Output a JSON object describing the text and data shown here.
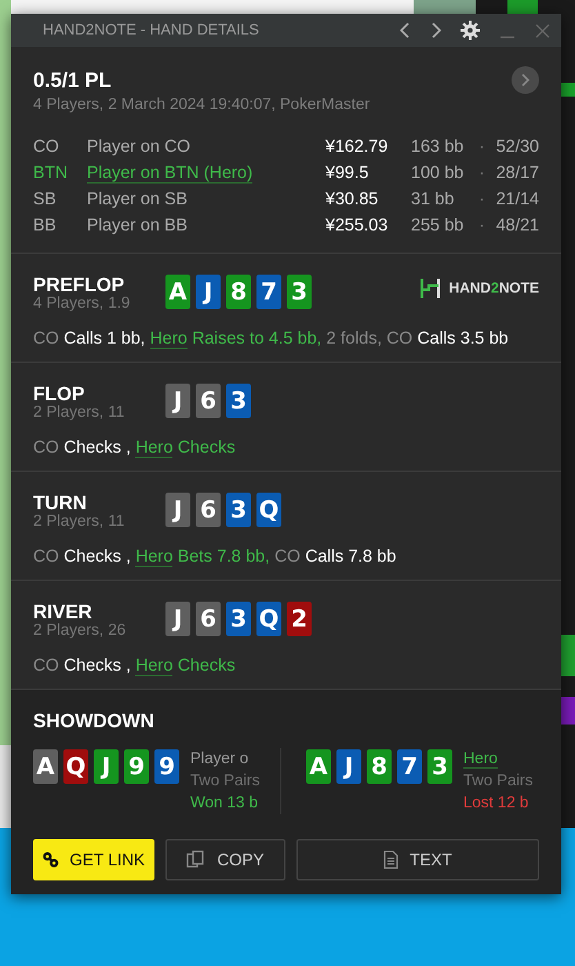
{
  "window": {
    "title": "HAND2NOTE - HAND DETAILS"
  },
  "header": {
    "title": "0.5/1 PL",
    "subtitle": "4 Players, 2 March 2024 19:40:07, PokerMaster"
  },
  "players": [
    {
      "position": "CO",
      "name": "Player on CO",
      "stack": "¥162.79",
      "bb": "163 bb",
      "stats": "52/30",
      "sep": "·",
      "hero": false
    },
    {
      "position": "BTN",
      "name": "Player on BTN (Hero)",
      "stack": "¥99.5",
      "bb": "100 bb",
      "stats": "28/17",
      "sep": "·",
      "hero": true
    },
    {
      "position": "SB",
      "name": "Player on SB",
      "stack": "¥30.85",
      "bb": "31 bb",
      "stats": "21/14",
      "sep": "·",
      "hero": false
    },
    {
      "position": "BB",
      "name": "Player on BB",
      "stack": "¥255.03",
      "bb": "255 bb",
      "stats": "48/21",
      "sep": "·",
      "hero": false
    }
  ],
  "streets": [
    {
      "name": "PREFLOP",
      "info": "4 Players, 1.9",
      "logo": [
        {
          "text": "HAND",
          "accent": false
        },
        {
          "text": "2",
          "accent": true
        },
        {
          "text": "NOTE",
          "accent": false
        }
      ],
      "cards": [
        {
          "rank": "A",
          "color": "#15951f"
        },
        {
          "rank": "J",
          "color": "#0b5cb3"
        },
        {
          "rank": "8",
          "color": "#15951f"
        },
        {
          "rank": "7",
          "color": "#0b5cb3"
        },
        {
          "rank": "3",
          "color": "#15951f"
        }
      ],
      "actions": [
        {
          "kind": "player",
          "text": "CO"
        },
        {
          "kind": "action",
          "text": " Calls 1 bb, "
        },
        {
          "kind": "hero",
          "text": "Hero"
        },
        {
          "kind": "hero_action",
          "text": " Raises to 4.5 bb,"
        },
        {
          "kind": "player",
          "text": " 2 folds, CO"
        },
        {
          "kind": "action",
          "text": " Calls 3.5 bb"
        }
      ]
    },
    {
      "name": "FLOP",
      "info": "2 Players, 11",
      "cards": [
        {
          "rank": "J",
          "color": "#5f5f5f"
        },
        {
          "rank": "6",
          "color": "#5f5f5f"
        },
        {
          "rank": "3",
          "color": "#0b5cb3"
        }
      ],
      "actions": [
        {
          "kind": "player",
          "text": "CO"
        },
        {
          "kind": "action",
          "text": " Checks , "
        },
        {
          "kind": "hero",
          "text": "Hero"
        },
        {
          "kind": "hero_action",
          "text": " Checks"
        }
      ]
    },
    {
      "name": "TURN",
      "info": "2 Players, 11",
      "cards": [
        {
          "rank": "J",
          "color": "#5f5f5f"
        },
        {
          "rank": "6",
          "color": "#5f5f5f"
        },
        {
          "rank": "3",
          "color": "#0b5cb3"
        },
        {
          "rank": "Q",
          "color": "#0b5cb3"
        }
      ],
      "actions": [
        {
          "kind": "player",
          "text": "CO"
        },
        {
          "kind": "action",
          "text": " Checks , "
        },
        {
          "kind": "hero",
          "text": "Hero"
        },
        {
          "kind": "hero_action",
          "text": " Bets 7.8 bb,"
        },
        {
          "kind": "player",
          "text": " CO"
        },
        {
          "kind": "action",
          "text": " Calls 7.8 bb"
        }
      ]
    },
    {
      "name": "RIVER",
      "info": "2 Players, 26",
      "cards": [
        {
          "rank": "J",
          "color": "#5f5f5f"
        },
        {
          "rank": "6",
          "color": "#5f5f5f"
        },
        {
          "rank": "3",
          "color": "#0b5cb3"
        },
        {
          "rank": "Q",
          "color": "#0b5cb3"
        },
        {
          "rank": "2",
          "color": "#a00d0d"
        }
      ],
      "actions": [
        {
          "kind": "player",
          "text": "CO"
        },
        {
          "kind": "action",
          "text": " Checks , "
        },
        {
          "kind": "hero",
          "text": "Hero"
        },
        {
          "kind": "hero_action",
          "text": " Checks"
        }
      ]
    }
  ],
  "showdown": {
    "title": "SHOWDOWN",
    "hands": [
      {
        "name": "Player o",
        "hero": false,
        "hand": "Two Pairs",
        "result": "Won 13 b",
        "won": true,
        "cards": [
          {
            "rank": "A",
            "color": "#5f5f5f"
          },
          {
            "rank": "Q",
            "color": "#a00d0d"
          },
          {
            "rank": "J",
            "color": "#15951f"
          },
          {
            "rank": "9",
            "color": "#15951f"
          },
          {
            "rank": "9",
            "color": "#0b5cb3"
          }
        ]
      },
      {
        "name": "Hero",
        "hero": true,
        "hand": "Two Pairs",
        "result": "Lost 12 b",
        "won": false,
        "cards": [
          {
            "rank": "A",
            "color": "#15951f"
          },
          {
            "rank": "J",
            "color": "#0b5cb3"
          },
          {
            "rank": "8",
            "color": "#15951f"
          },
          {
            "rank": "7",
            "color": "#0b5cb3"
          },
          {
            "rank": "3",
            "color": "#15951f"
          }
        ]
      }
    ]
  },
  "buttons": [
    {
      "kind": "link",
      "label": "GET LINK"
    },
    {
      "kind": "copy",
      "label": "COPY"
    },
    {
      "kind": "text",
      "label": "TEXT"
    }
  ]
}
